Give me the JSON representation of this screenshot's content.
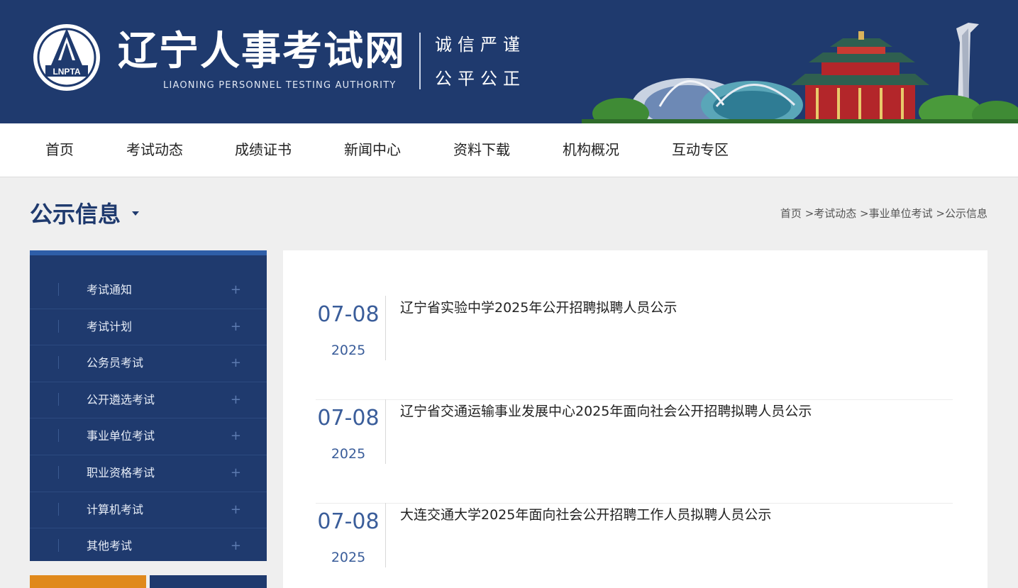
{
  "header": {
    "logo_text": "LNPTA",
    "title": "辽宁人事考试网",
    "subtitle": "LIAONING PERSONNEL TESTING AUTHORITY",
    "slogan_line1": "诚信严谨",
    "slogan_line2": "公平公正"
  },
  "nav": {
    "items": [
      {
        "label": "首页"
      },
      {
        "label": "考试动态"
      },
      {
        "label": "成绩证书"
      },
      {
        "label": "新闻中心"
      },
      {
        "label": "资料下载"
      },
      {
        "label": "机构概况"
      },
      {
        "label": "互动专区"
      }
    ]
  },
  "page": {
    "title": "公示信息"
  },
  "breadcrumb": {
    "items": [
      "首页",
      "考试动态",
      "事业单位考试",
      "公示信息"
    ],
    "separator": " >"
  },
  "sidebar": {
    "items": [
      {
        "label": "考试通知",
        "icon": "plus-icon"
      },
      {
        "label": "考试计划",
        "icon": "plus-icon"
      },
      {
        "label": "公务员考试",
        "icon": "plus-icon"
      },
      {
        "label": "公开遴选考试",
        "icon": "plus-icon"
      },
      {
        "label": "事业单位考试",
        "icon": "plus-icon"
      },
      {
        "label": "职业资格考试",
        "icon": "plus-icon"
      },
      {
        "label": "计算机考试",
        "icon": "plus-icon"
      },
      {
        "label": "其他考试",
        "icon": "plus-icon"
      }
    ],
    "plus_symbol": "+"
  },
  "news": {
    "items": [
      {
        "date": "07-08",
        "year": "2025",
        "title": "辽宁省实验中学2025年公开招聘拟聘人员公示"
      },
      {
        "date": "07-08",
        "year": "2025",
        "title": "辽宁省交通运输事业发展中心2025年面向社会公开招聘拟聘人员公示"
      },
      {
        "date": "07-08",
        "year": "2025",
        "title": "大连交通大学2025年面向社会公开招聘工作人员拟聘人员公示"
      }
    ]
  },
  "colors": {
    "brand_navy": "#1f3a6e",
    "sidebar_accent": "#2e5ea8",
    "orange": "#e0891b",
    "date_blue": "#3a5d9a"
  }
}
